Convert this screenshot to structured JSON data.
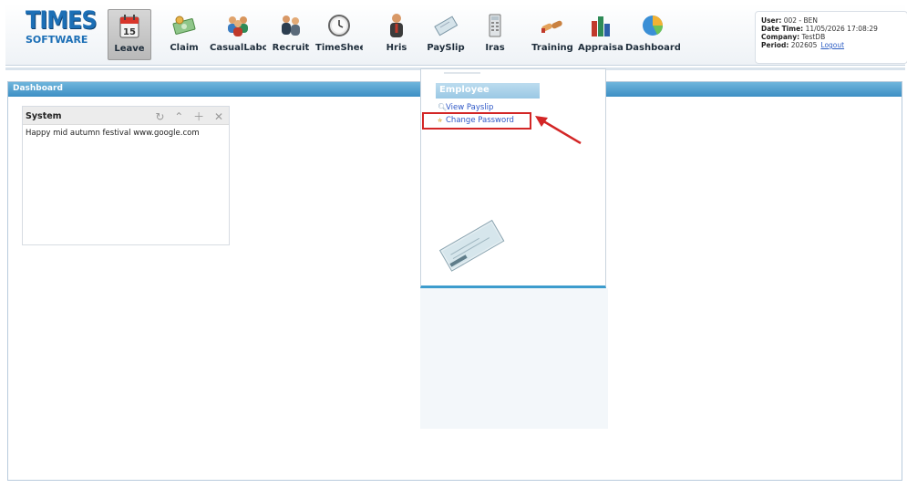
{
  "logo": {
    "line1": "TIMES",
    "line2": "SOFTWARE"
  },
  "nav": [
    {
      "label": "Leave",
      "icon": "calendar-icon",
      "active": true
    },
    {
      "label": "Claim",
      "icon": "money-icon"
    },
    {
      "label": "CasualLabour",
      "icon": "group-icon"
    },
    {
      "label": "Recruit",
      "icon": "people-icon"
    },
    {
      "label": "TimeSheet",
      "icon": "clock-icon"
    },
    {
      "label": "Hris",
      "icon": "person-icon"
    },
    {
      "label": "PaySlip",
      "icon": "payslip-icon"
    },
    {
      "label": "Iras",
      "icon": "calculator-icon"
    },
    {
      "label": "Training",
      "icon": "handshake-icon"
    },
    {
      "label": "Appraisal",
      "icon": "bar-chart-icon"
    },
    {
      "label": "Dashboard",
      "icon": "pie-chart-icon"
    }
  ],
  "calendar_day": "15",
  "user": {
    "user_label": "User:",
    "user_value": "002 - BEN",
    "datetime_label": "Date Time:",
    "datetime_value": "11/05/2026 17:08:29",
    "company_label": "Company:",
    "company_value": "TestDB",
    "period_label": "Period:",
    "period_value": "202605",
    "logout": "Logout"
  },
  "dashboard": {
    "title": "Dashboard"
  },
  "system_box": {
    "title": "System",
    "message": "Happy mid autumn festival www.google.com"
  },
  "dropdown": {
    "category": "Employee",
    "items": [
      "View Payslip",
      "Change Password"
    ]
  },
  "colors": {
    "accent": "#3d8fc4",
    "link": "#2f58c7",
    "highlight": "#d32626"
  }
}
